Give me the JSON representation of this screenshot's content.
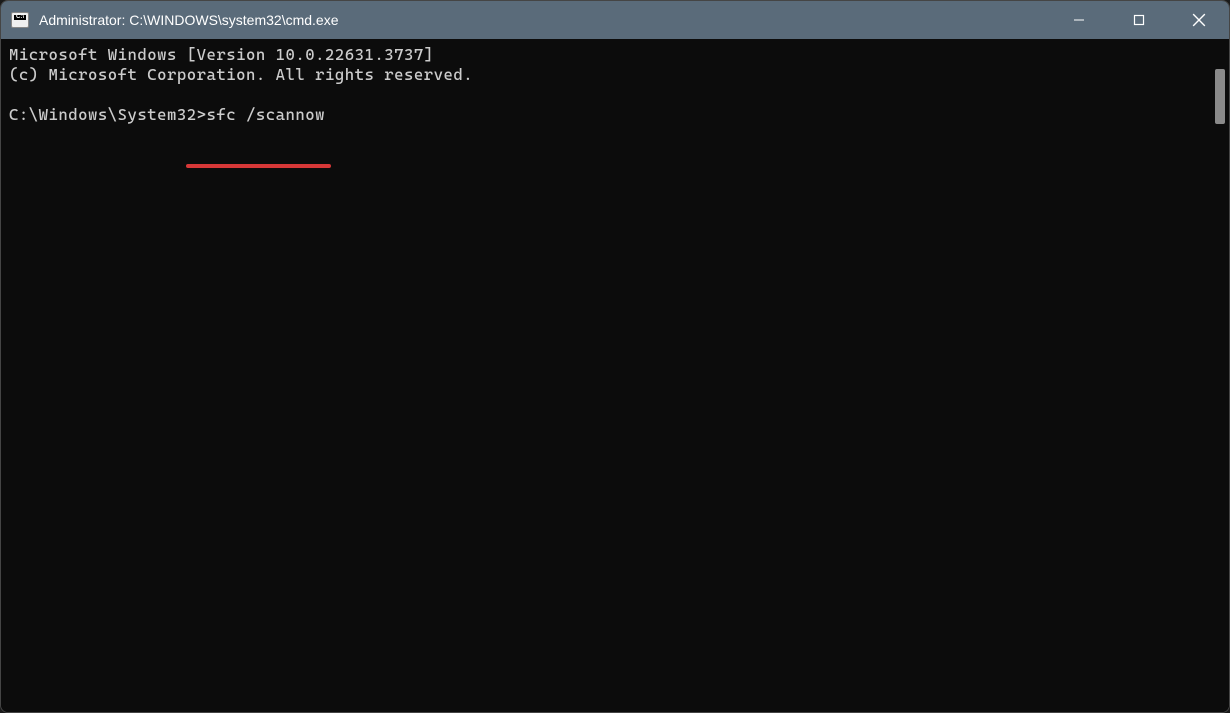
{
  "window": {
    "title": "Administrator: C:\\WINDOWS\\system32\\cmd.exe",
    "icon_label": "C:\\"
  },
  "terminal": {
    "line1": "Microsoft Windows [Version 10.0.22631.3737]",
    "line2": "(c) Microsoft Corporation. All rights reserved.",
    "blank": "",
    "prompt_path": "C:\\Windows\\System32>",
    "command": "sfc /scannow"
  },
  "annotation": {
    "underline_color": "#d73838"
  }
}
